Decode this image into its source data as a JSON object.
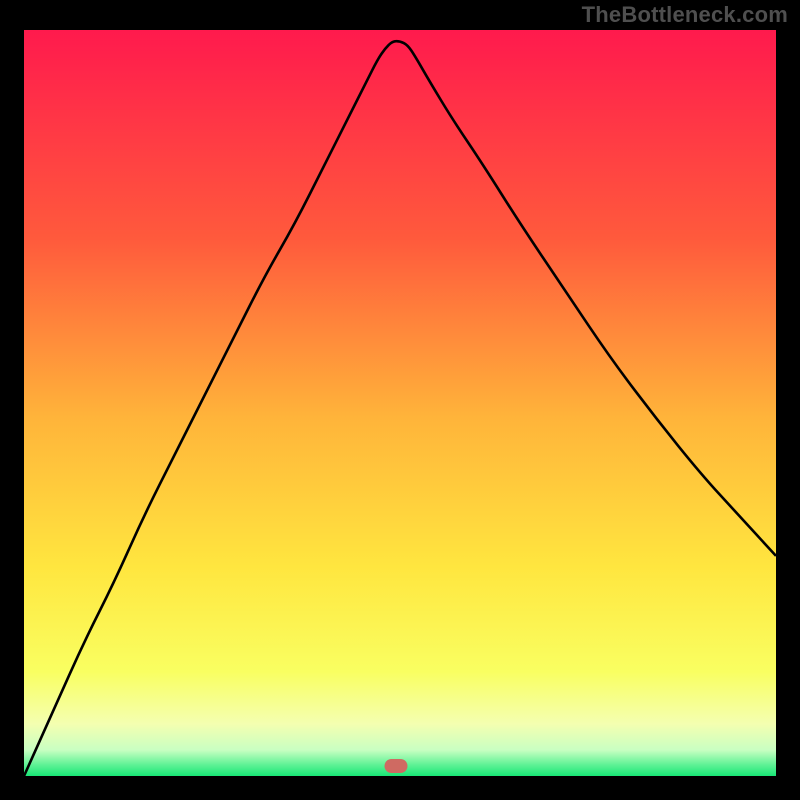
{
  "attribution": "TheBottleneck.com",
  "colors": {
    "page_bg": "#000000",
    "attribution_text": "#4f4f4f",
    "curve": "#000000",
    "marker": "#cf6a62",
    "gradient_stops": [
      {
        "offset": 0.0,
        "color": "#ff1a4d"
      },
      {
        "offset": 0.28,
        "color": "#ff5a3c"
      },
      {
        "offset": 0.52,
        "color": "#ffb43a"
      },
      {
        "offset": 0.72,
        "color": "#ffe63f"
      },
      {
        "offset": 0.86,
        "color": "#f9ff61"
      },
      {
        "offset": 0.93,
        "color": "#f4ffb0"
      },
      {
        "offset": 0.965,
        "color": "#c9ffc2"
      },
      {
        "offset": 0.985,
        "color": "#5ef295"
      },
      {
        "offset": 1.0,
        "color": "#19e676"
      }
    ]
  },
  "chart_data": {
    "type": "line",
    "title": "",
    "xlabel": "",
    "ylabel": "",
    "xlim": [
      0,
      1
    ],
    "ylim": [
      0,
      1
    ],
    "grid": false,
    "legend": false,
    "marker_xy_fraction": [
      0.495,
      0.986
    ],
    "series": [
      {
        "name": "bottleneck-curve",
        "x": [
          0.0,
          0.04,
          0.08,
          0.12,
          0.16,
          0.2,
          0.24,
          0.28,
          0.32,
          0.36,
          0.4,
          0.43,
          0.455,
          0.47,
          0.48,
          0.49,
          0.5,
          0.51,
          0.52,
          0.54,
          0.57,
          0.61,
          0.66,
          0.72,
          0.78,
          0.84,
          0.9,
          0.95,
          1.0
        ],
        "y": [
          0.0,
          0.09,
          0.18,
          0.26,
          0.35,
          0.43,
          0.51,
          0.59,
          0.67,
          0.74,
          0.82,
          0.88,
          0.93,
          0.96,
          0.975,
          0.985,
          0.985,
          0.98,
          0.965,
          0.93,
          0.88,
          0.82,
          0.74,
          0.65,
          0.56,
          0.48,
          0.405,
          0.35,
          0.295
        ]
      }
    ]
  }
}
